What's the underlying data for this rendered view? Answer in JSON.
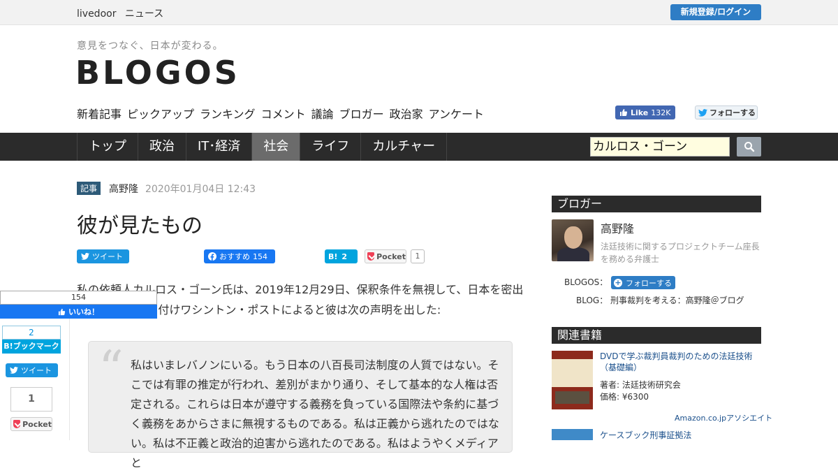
{
  "topbar": {
    "brand1": "livedoor",
    "brand2": "ニュース",
    "login": "新規登録/ログイン"
  },
  "header": {
    "tagline": "意見をつなぐ、日本が変わる。",
    "logo": "BLOGOS",
    "subnav": [
      "新着記事",
      "ピックアップ",
      "ランキング",
      "コメント",
      "議論",
      "ブロガー",
      "政治家",
      "アンケート"
    ],
    "fb_like": {
      "label": "Like",
      "count": "132K"
    },
    "tw_follow": "フォローする"
  },
  "navbar": {
    "items": [
      "トップ",
      "政治",
      "IT･経済",
      "社会",
      "ライフ",
      "カルチャー"
    ],
    "active": "社会",
    "search_value": "カルロス・ゴーン"
  },
  "article": {
    "category": "記事",
    "author": "高野隆",
    "date": "2020年01月04日 12:43",
    "title": "彼が見たもの",
    "share": {
      "tweet": "ツイート",
      "fb_label": "おすすめ",
      "fb_count": "154",
      "hatena_label": "B!",
      "hatena_count": "2",
      "pocket_label": "Pocket",
      "pocket_count": "1"
    },
    "body_line1": "私の依頼人カルロス・ゴーン氏は、2019年12月29日、保釈条件を無視して、日本を密出",
    "body_line2": "国した。1月2日付けワシントン・ポストによると彼は次の声明を出した:",
    "quote": "私はいまレバノンにいる。もう日本の八百長司法制度の人質ではない。そこでは有罪の推定が行われ、差別がまかり通り、そして基本的な人権は否定される。これらは日本が遵守する義務を負っている国際法や条約に基づく義務をあからさまに無視するものである。私は正義から逃れたのではない。私は不正義と政治的迫害から逃れたのである。私はようやくメディアと"
  },
  "floating_share": {
    "fb_count": "154",
    "fb_label": "いいね！",
    "hatena_count": "2",
    "hatena_label": "B!ブックマーク",
    "tweet": "ツイート",
    "pocket_count": "1",
    "pocket_label": "Pocket"
  },
  "sidebar": {
    "blogger_heading": "ブロガー",
    "blogger_name": "高野隆",
    "blogger_desc": "法廷技術に関するプロジェクトチーム座長を務める弁護士",
    "blogos_label": "BLOGOS：",
    "follow_label": "フォローする",
    "blog_label": "BLOG：",
    "blog_link": "刑事裁判を考える：高野隆＠ブログ",
    "books_heading": "関連書籍",
    "book1": {
      "title": "DVDで学ぶ裁判員裁判のための法廷技術（基礎編）",
      "author": "著者: 法廷技術研究会",
      "price": "価格: ¥6300"
    },
    "amazon": "Amazon.co.jpアソシエイト",
    "book2": {
      "title": "ケースブック刑事証拠法"
    }
  },
  "colors": {
    "accent_blue": "#2e7dc5",
    "navbar": "#2b2b2b",
    "active_nav": "#6b6b6b",
    "badge": "#2d5a78"
  }
}
